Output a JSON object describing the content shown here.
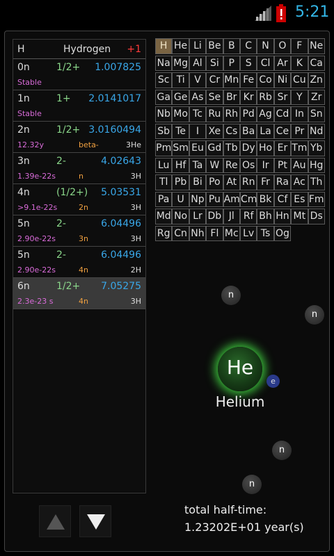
{
  "status": {
    "time": "5:21"
  },
  "element": {
    "symbol": "H",
    "name": "Hydrogen",
    "charge": "+1"
  },
  "isotopes": [
    {
      "name": "0n",
      "spin": "1/2+",
      "mass": "1.007825",
      "halflife": "Stable",
      "decay": "",
      "product": ""
    },
    {
      "name": "1n",
      "spin": "1+",
      "mass": "2.0141017",
      "halflife": "Stable",
      "decay": "",
      "product": ""
    },
    {
      "name": "2n",
      "spin": "1/2+",
      "mass": "3.0160494",
      "halflife": "12.32y",
      "decay": "beta-",
      "product": "3He"
    },
    {
      "name": "3n",
      "spin": "2-",
      "mass": "4.02643",
      "halflife": "1.39e-22s",
      "decay": "n",
      "product": "3H"
    },
    {
      "name": "4n",
      "spin": "(1/2+)",
      "mass": "5.03531",
      "halflife": ">9.1e-22s",
      "decay": "2n",
      "product": "3H"
    },
    {
      "name": "5n",
      "spin": "2-",
      "mass": "6.04496",
      "halflife": "2.90e-22s",
      "decay": "3n",
      "product": "3H"
    },
    {
      "name": "5n",
      "spin": "2-",
      "mass": "6.04496",
      "halflife": "2.90e-22s",
      "decay": "4n",
      "product": "2H"
    },
    {
      "name": "6n",
      "spin": "1/2+",
      "mass": "7.05275",
      "halflife": "2.3e-23 s",
      "decay": "4n",
      "product": "3H"
    }
  ],
  "selected_isotope_index": 7,
  "periodic_table": [
    [
      "H",
      "He",
      "Li",
      "Be",
      "B",
      "C",
      "N",
      "O",
      "F",
      "Ne"
    ],
    [
      "Na",
      "Mg",
      "Al",
      "Si",
      "P",
      "S",
      "Cl",
      "Ar",
      "K",
      "Ca"
    ],
    [
      "Sc",
      "Ti",
      "V",
      "Cr",
      "Mn",
      "Fe",
      "Co",
      "Ni",
      "Cu",
      "Zn"
    ],
    [
      "Ga",
      "Ge",
      "As",
      "Se",
      "Br",
      "Kr",
      "Rb",
      "Sr",
      "Y",
      "Zr"
    ],
    [
      "Nb",
      "Mo",
      "Tc",
      "Ru",
      "Rh",
      "Pd",
      "Ag",
      "Cd",
      "In",
      "Sn"
    ],
    [
      "Sb",
      "Te",
      "I",
      "Xe",
      "Cs",
      "Ba",
      "La",
      "Ce",
      "Pr",
      "Nd"
    ],
    [
      "Pm",
      "Sm",
      "Eu",
      "Gd",
      "Tb",
      "Dy",
      "Ho",
      "Er",
      "Tm",
      "Yb"
    ],
    [
      "Lu",
      "Hf",
      "Ta",
      "W",
      "Re",
      "Os",
      "Ir",
      "Pt",
      "Au",
      "Hg"
    ],
    [
      "Tl",
      "Pb",
      "Bi",
      "Po",
      "At",
      "Rn",
      "Fr",
      "Ra",
      "Ac",
      "Th"
    ],
    [
      "Pa",
      "U",
      "Np",
      "Pu",
      "Am",
      "Cm",
      "Bk",
      "Cf",
      "Es",
      "Fm"
    ],
    [
      "Md",
      "No",
      "Lr",
      "Db",
      "Jl",
      "Rf",
      "Bh",
      "Hn",
      "Mt",
      "Ds"
    ],
    [
      "Rg",
      "Cn",
      "Nh",
      "Fl",
      "Mc",
      "Lv",
      "Ts",
      "Og"
    ]
  ],
  "active_element": "H",
  "atom": {
    "nucleus_symbol": "He",
    "element_name": "Helium",
    "electron_label": "e",
    "neutron_label": "n"
  },
  "halftime": {
    "label": "total half-time:",
    "value": "1.23202E+01 year(s)"
  },
  "icons": {
    "signal": "signal-icon",
    "battery": "battery-alert-icon",
    "up": "arrow-up-icon",
    "down": "arrow-down-icon"
  }
}
